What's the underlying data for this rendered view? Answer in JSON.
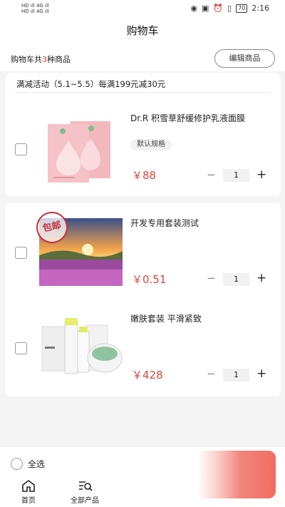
{
  "statusbar": {
    "left_top": "HD ıll 4G ıll",
    "left_bottom": "HD ıll 4G ıll",
    "battery": "70",
    "time": "2:16"
  },
  "header": {
    "title": "购物车"
  },
  "summary": {
    "prefix": "购物车共",
    "count": "3",
    "suffix": "种商品",
    "edit_label": "编辑商品"
  },
  "group1": {
    "promo": "满减活动（5.1~5.5）每满199元减30元",
    "items": [
      {
        "name": "Dr.R 积雪草舒缓修护乳液面膜",
        "spec": "默认规格",
        "price": "￥88",
        "qty": "1"
      }
    ]
  },
  "group2": {
    "items": [
      {
        "name": "开发专用套装测试",
        "price": "￥0.51",
        "qty": "1",
        "badge": "包邮"
      },
      {
        "name": "嫩肤套装 平滑紧致",
        "price": "￥428",
        "qty": "1"
      }
    ]
  },
  "controls": {
    "minus": "−",
    "plus": "+"
  },
  "bottom": {
    "select_all": "全选"
  },
  "tabbar": [
    {
      "label": "首页",
      "icon": "home-icon"
    },
    {
      "label": "全部产品",
      "icon": "product-list-icon"
    }
  ],
  "colors": {
    "price": "#d9473b",
    "checkout": "#ef6d62",
    "count": "#e0443a"
  }
}
